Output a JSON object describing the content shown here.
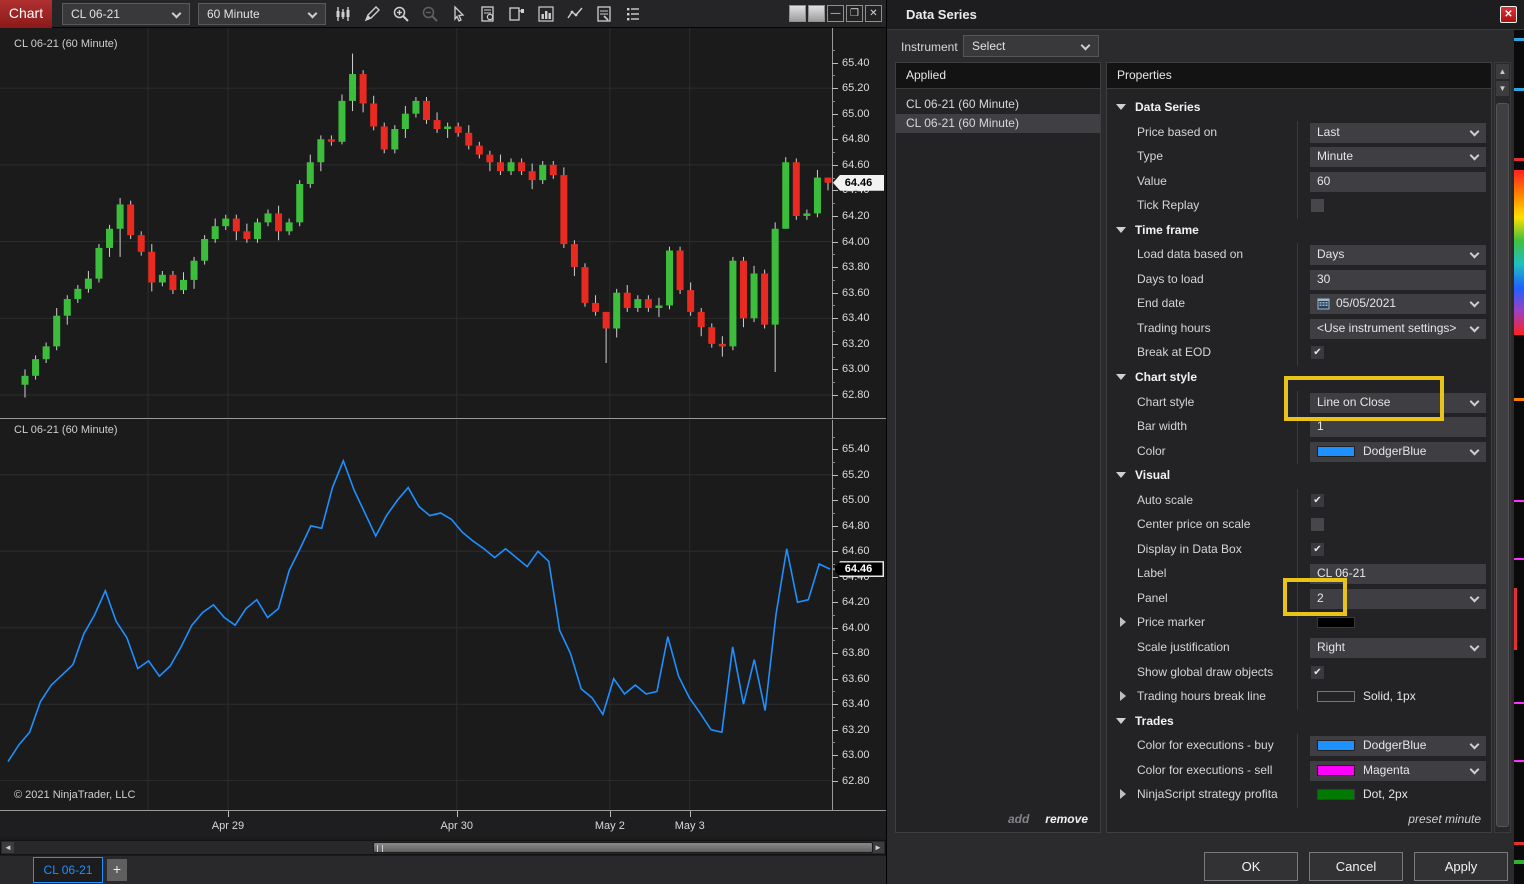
{
  "toolbar": {
    "chart_button": "Chart",
    "instrument": "CL 06-21",
    "interval": "60 Minute",
    "icons": [
      {
        "name": "chart-style-icon"
      },
      {
        "name": "drawing-tools-icon"
      },
      {
        "name": "zoom-in-icon"
      },
      {
        "name": "zoom-out-icon"
      },
      {
        "name": "cursor-icon"
      },
      {
        "name": "data-box-icon"
      },
      {
        "name": "chart-trader-icon"
      },
      {
        "name": "indicators-icon"
      },
      {
        "name": "strategies-icon"
      },
      {
        "name": "script-editor-icon"
      },
      {
        "name": "properties-icon"
      }
    ],
    "window_buttons": [
      {
        "name": "window-snap-icon",
        "glyph": "",
        "filled": true
      },
      {
        "name": "window-pin-icon",
        "glyph": "",
        "filled": true
      },
      {
        "name": "minimize-icon",
        "glyph": "—",
        "filled": false
      },
      {
        "name": "maximize-icon",
        "glyph": "❐",
        "filled": false
      },
      {
        "name": "close-window-icon",
        "glyph": "✕",
        "filled": false
      }
    ]
  },
  "chart": {
    "panel1_label": "CL 06-21 (60 Minute)",
    "panel2_label": "CL 06-21 (60 Minute)",
    "copyright": "© 2021 NinjaTrader, LLC",
    "price_marker": "64.46",
    "tab": "CL 06-21",
    "tab_add": "+"
  },
  "chart_data": {
    "type": [
      "candlestick",
      "line"
    ],
    "title": "CL 06-21 (60 Minute)",
    "instrument": "CL 06-21",
    "interval_minutes": 60,
    "last_price": 64.46,
    "y_tick_labels": [
      "65.40",
      "65.20",
      "65.00",
      "64.80",
      "64.60",
      "64.40",
      "64.20",
      "64.00",
      "63.80",
      "63.60",
      "63.40",
      "63.20",
      "63.00",
      "62.80"
    ],
    "panel1_price_range": [
      62.62,
      65.67
    ],
    "panel2_price_range": [
      62.57,
      65.63
    ],
    "x_ticks": [
      {
        "label": "Apr 29",
        "f": 0.274
      },
      {
        "label": "Apr 30",
        "f": 0.549
      },
      {
        "label": "May 2",
        "f": 0.733
      },
      {
        "label": "May 3",
        "f": 0.829
      }
    ],
    "grid_v_fractions": [
      0.178,
      0.274,
      0.549,
      0.733,
      0.829
    ],
    "grid_h_prices": [
      65.2,
      64.6,
      64.0,
      63.4,
      62.8
    ],
    "up_color": "#3CBE3C",
    "down_color": "#E82A20",
    "line_color": "#1E90FF",
    "first_open": 62.88,
    "closes": [
      62.95,
      63.08,
      63.18,
      63.42,
      63.55,
      63.63,
      63.71,
      63.95,
      64.1,
      64.29,
      64.05,
      63.92,
      63.68,
      63.74,
      63.62,
      63.7,
      63.85,
      64.02,
      64.12,
      64.18,
      64.08,
      64.02,
      64.15,
      64.22,
      64.08,
      64.15,
      64.45,
      64.62,
      64.8,
      64.78,
      65.1,
      65.31,
      65.08,
      64.9,
      64.72,
      64.88,
      65.0,
      65.1,
      64.95,
      64.88,
      64.9,
      64.85,
      64.75,
      64.68,
      64.62,
      64.55,
      64.62,
      64.55,
      64.48,
      64.6,
      64.52,
      63.98,
      63.8,
      63.52,
      63.45,
      63.32,
      63.6,
      63.48,
      63.55,
      63.48,
      63.5,
      63.93,
      63.62,
      63.45,
      63.33,
      63.2,
      63.18,
      63.85,
      63.4,
      63.75,
      63.35,
      64.1,
      64.62,
      64.2,
      64.22,
      64.5,
      64.46
    ],
    "wick_overrides": {
      "0": [
        63.0,
        62.78
      ],
      "9": [
        64.34,
        63.88
      ],
      "30": [
        65.15,
        64.76
      ],
      "31": [
        65.47,
        65.02
      ],
      "55": [
        63.38,
        63.05
      ],
      "66": [
        63.26,
        63.1
      ],
      "71": [
        64.15,
        62.98
      ],
      "72": [
        64.66,
        64.1
      ],
      "76": [
        64.5,
        64.4
      ]
    }
  },
  "dialog": {
    "title": "Data Series",
    "close_glyph": "✕",
    "instrument_label": "Instrument",
    "instrument_value": "Select",
    "applied_header": "Applied",
    "applied_items": [
      {
        "label": "CL 06-21 (60 Minute)",
        "selected": false
      },
      {
        "label": "CL 06-21 (60 Minute)",
        "selected": true
      }
    ],
    "properties_header": "Properties",
    "rows": [
      {
        "kind": "section",
        "label": "Data Series"
      },
      {
        "kind": "dropdown",
        "label": "Price based on",
        "value": "Last"
      },
      {
        "kind": "dropdown",
        "label": "Type",
        "value": "Minute"
      },
      {
        "kind": "input",
        "label": "Value",
        "value": "60"
      },
      {
        "kind": "checkbox",
        "label": "Tick Replay",
        "checked": false
      },
      {
        "kind": "section",
        "label": "Time frame"
      },
      {
        "kind": "dropdown",
        "label": "Load data based on",
        "value": "Days"
      },
      {
        "kind": "input",
        "label": "Days to load",
        "value": "30"
      },
      {
        "kind": "date",
        "label": "End date",
        "value": "05/05/2021"
      },
      {
        "kind": "dropdown",
        "label": "Trading hours",
        "value": "<Use instrument settings>"
      },
      {
        "kind": "checkbox",
        "label": "Break at EOD",
        "checked": true
      },
      {
        "kind": "section",
        "label": "Chart style"
      },
      {
        "kind": "dropdown",
        "label": "Chart style",
        "value": "Line on Close"
      },
      {
        "kind": "input",
        "label": "Bar width",
        "value": "1"
      },
      {
        "kind": "swatch",
        "label": "Color",
        "value": "DodgerBlue",
        "color": "#1E90FF"
      },
      {
        "kind": "section",
        "label": "Visual"
      },
      {
        "kind": "checkbox",
        "label": "Auto scale",
        "checked": true
      },
      {
        "kind": "checkbox",
        "label": "Center price on scale",
        "checked": false
      },
      {
        "kind": "checkbox",
        "label": "Display in Data Box",
        "checked": true
      },
      {
        "kind": "input",
        "label": "Label",
        "value": "CL 06-21"
      },
      {
        "kind": "dropdown",
        "label": "Panel",
        "value": "2"
      },
      {
        "kind": "chip",
        "label": "Price marker",
        "color": "#000000",
        "expander": true
      },
      {
        "kind": "dropdown",
        "label": "Scale justification",
        "value": "Right"
      },
      {
        "kind": "checkbox",
        "label": "Show global draw objects",
        "checked": true
      },
      {
        "kind": "linestyle",
        "label": "Trading hours break line",
        "value": "Solid, 1px",
        "color": "",
        "expander": true
      },
      {
        "kind": "section",
        "label": "Trades"
      },
      {
        "kind": "swatch",
        "label": "Color for executions - buy",
        "value": "DodgerBlue",
        "color": "#1E90FF"
      },
      {
        "kind": "swatch",
        "label": "Color for executions - sell",
        "value": "Magenta",
        "color": "#FF00FF"
      },
      {
        "kind": "linestyle",
        "label": "NinjaScript strategy profita",
        "value": "Dot, 2px",
        "color": "#007A00",
        "expander": true
      }
    ],
    "add_label": "add",
    "remove_label": "remove",
    "preset_label": "preset minute",
    "buttons": [
      "OK",
      "Cancel",
      "Apply"
    ],
    "highlight_color": "#e9c319"
  }
}
